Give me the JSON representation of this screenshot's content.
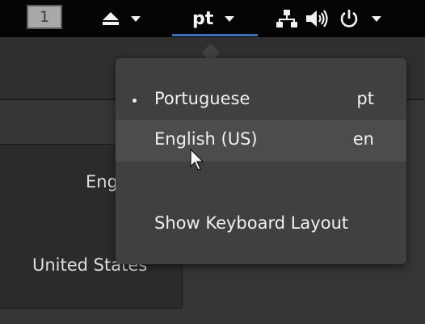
{
  "topbar": {
    "workspace_number": "1",
    "input_source": "pt",
    "icons": [
      "eject-icon",
      "network-icon",
      "volume-icon",
      "power-icon"
    ]
  },
  "menu": {
    "items": [
      {
        "label": "Portuguese",
        "code": "pt",
        "selected": true,
        "highlighted": false
      },
      {
        "label": "English (US)",
        "code": "en",
        "selected": false,
        "highlighted": true
      }
    ],
    "show_layout_label": "Show Keyboard Layout"
  },
  "background": {
    "field_partial": "Eng",
    "region": "United States"
  },
  "colors": {
    "topbar": "#050505",
    "menu": "#3f4040",
    "menu_hover": "#4b4c4c",
    "accent_underline": "#3d6fb0"
  }
}
